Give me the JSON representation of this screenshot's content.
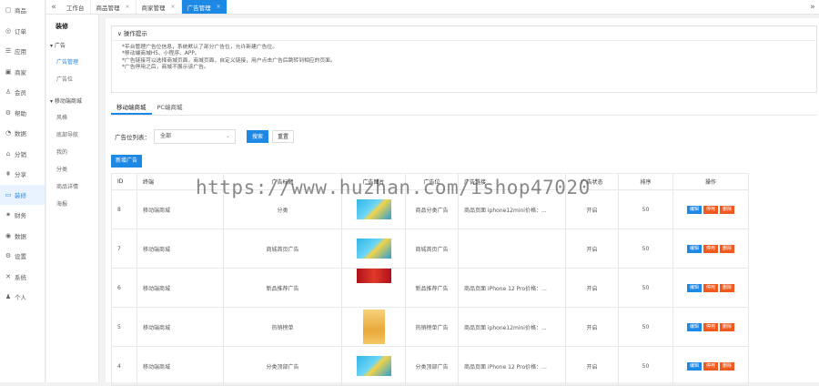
{
  "nav": [
    {
      "icon": "box-icon",
      "glyph": "▢",
      "label": "商品"
    },
    {
      "icon": "order-icon",
      "glyph": "◎",
      "label": "订单"
    },
    {
      "icon": "app-icon",
      "glyph": "☰",
      "label": "应用"
    },
    {
      "icon": "shop-icon",
      "glyph": "▣",
      "label": "商家"
    },
    {
      "icon": "member-icon",
      "glyph": "♙",
      "label": "会员"
    },
    {
      "icon": "help-icon",
      "glyph": "⚙",
      "label": "帮助"
    },
    {
      "icon": "data-icon",
      "glyph": "◔",
      "label": "数据"
    },
    {
      "icon": "store-icon",
      "glyph": "⌂",
      "label": "分销"
    },
    {
      "icon": "shopping-icon",
      "glyph": "⩩",
      "label": "分享"
    },
    {
      "icon": "decorate-icon",
      "glyph": "▭",
      "label": "装修",
      "active": true
    },
    {
      "icon": "finance-icon",
      "glyph": "✷",
      "label": "财务"
    },
    {
      "icon": "stats-icon",
      "glyph": "◉",
      "label": "数据"
    },
    {
      "icon": "settings-icon",
      "glyph": "⚙",
      "label": "设置"
    },
    {
      "icon": "system-icon",
      "glyph": "✕",
      "label": "系统"
    },
    {
      "icon": "user-icon",
      "glyph": "♟",
      "label": "个人"
    }
  ],
  "subnav": {
    "title": "装修",
    "group1": "▾ 广告",
    "group1_items": [
      {
        "label": "广告管理",
        "active": true
      },
      {
        "label": "广告位"
      }
    ],
    "group2": "▾ 移动端商城",
    "group2_items": [
      {
        "label": "风格"
      },
      {
        "label": "底部导航"
      },
      {
        "label": "我的"
      },
      {
        "label": "分类"
      },
      {
        "label": "商品详情"
      },
      {
        "label": "海报"
      }
    ]
  },
  "topbar": {
    "collapse": "«",
    "tabs": [
      {
        "label": "工作台",
        "close": ""
      },
      {
        "label": "商品管理",
        "close": "×"
      },
      {
        "label": "商家管理",
        "close": "×"
      },
      {
        "label": "广告管理",
        "close": "×",
        "active": true
      }
    ],
    "expand": "»"
  },
  "tips": {
    "title": "∨ 操作提示",
    "lines": [
      "*平台管理广告位信息，系统默认了部分广告位，允许新建广告位。",
      "*移动端商城H5、小程序、APP。",
      "*广告链接可以选择商城页面，商城页面，自定义链接，用户点击广告后跳转到相应的页面。",
      "*广告停用之后，商城不展示该广告。"
    ]
  },
  "page_tabs": [
    {
      "label": "移动端商城",
      "active": true
    },
    {
      "label": "PC端商城"
    }
  ],
  "filter": {
    "label": "广告位列表：",
    "value": "全部",
    "caret": "⌄",
    "search": "搜索",
    "reset": "重置"
  },
  "add_button": "新增广告",
  "table": {
    "headers": [
      "ID",
      "终端",
      "广告标题",
      "广告图片",
      "广告位",
      "广告链接",
      "广告状态",
      "排序",
      "操作"
    ],
    "rows": [
      {
        "id": "8",
        "terminal": "移动端商城",
        "title": "分类",
        "img": "banner-blue",
        "position": "商品分类广告",
        "link": "商品页面 iphone12mini价格：...",
        "status": "开启",
        "sort": "50"
      },
      {
        "id": "7",
        "terminal": "移动端商城",
        "title": "商城首页广告",
        "img": "banner-blue",
        "position": "商城首页广告",
        "link": "",
        "status": "开启",
        "sort": "50"
      },
      {
        "id": "6",
        "terminal": "移动端商城",
        "title": "新品推荐广告",
        "img": "banner-red",
        "position": "新品推荐广告",
        "link": "商品页面 iPhone 12 Pro价格：...",
        "status": "开启",
        "sort": "50"
      },
      {
        "id": "5",
        "terminal": "移动端商城",
        "title": "热销榜单",
        "img": "poster-gold",
        "position": "热销榜单广告",
        "link": "商品页面 iphone12mini价格：...",
        "status": "开启",
        "sort": "50"
      },
      {
        "id": "4",
        "terminal": "移动端商城",
        "title": "分类顶部广告",
        "img": "banner-blue",
        "position": "分类顶部广告",
        "link": "商品页面 iPhone 12 Pro价格：...",
        "status": "开启",
        "sort": "50"
      }
    ],
    "ops": {
      "edit": "编辑",
      "stop": "停用",
      "del": "删除"
    }
  },
  "watermark": "https://www.huzhan.com/ishop47020",
  "colors": {
    "accent": "#1e88e5",
    "danger": "#f05a1e"
  }
}
